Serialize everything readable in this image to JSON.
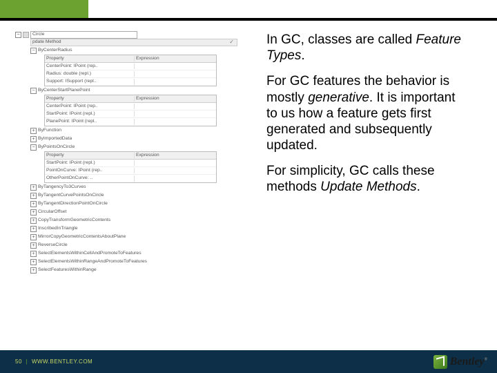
{
  "slide": {
    "paragraphs": [
      {
        "pre": "In GC, classes are called ",
        "em": "Feature Types",
        "post": "."
      },
      {
        "pre": "For GC features the behavior is mostly ",
        "em": "generative",
        "post": ". It is important to us how a feature gets first generated and subsequently updated."
      },
      {
        "pre": "For simplicity, GC calls these methods ",
        "em": "Update Methods",
        "post": "."
      }
    ]
  },
  "tree": {
    "root_exp": "−",
    "root_label": "Circle",
    "method_band": "pdate Method",
    "method_tail": "✓",
    "sections": [
      {
        "exp": "−",
        "label": "ByCenterRadius",
        "props_header": [
          "Property",
          "Expression"
        ],
        "props": [
          [
            "CenterPoint: IPoint (rep..",
            ""
          ],
          [
            "Radius: double (repl.)",
            ""
          ],
          [
            "Support: ISupport (repl..",
            ""
          ]
        ]
      },
      {
        "exp": "−",
        "label": "ByCenterStartPlanePoint",
        "props_header": [
          "Property",
          "Expression"
        ],
        "props": [
          [
            "CenterPoint: IPoint (rep..",
            ""
          ],
          [
            "StartPoint: IPoint (repl.)",
            ""
          ],
          [
            "PlanePoint: IPoint (repl..",
            ""
          ]
        ]
      }
    ],
    "mid_items": [
      {
        "exp": "+",
        "label": "ByFunction"
      },
      {
        "exp": "+",
        "label": "ByImportedData"
      },
      {
        "exp": "−",
        "label": "ByPointsOnCircle",
        "props_header": [
          "Property",
          "Expression"
        ],
        "props": [
          [
            "StartPoint: IPoint (repl.)",
            ""
          ],
          [
            "PointOnCurve: IPoint (rep..",
            ""
          ],
          [
            "OtherPointOnCurve: ..",
            ""
          ]
        ]
      }
    ],
    "tail_items": [
      {
        "exp": "+",
        "label": "ByTangencyTo3Curves"
      },
      {
        "exp": "+",
        "label": "ByTangentCurvePointsOnCircle"
      },
      {
        "exp": "+",
        "label": "ByTangentDirectionPointOnCircle"
      },
      {
        "exp": "+",
        "label": "CircularOffset"
      },
      {
        "exp": "+",
        "label": "CopyTransformGeometricContents"
      },
      {
        "exp": "+",
        "label": "InscribedInTriangle"
      },
      {
        "exp": "+",
        "label": "MirrorCopyGeometricContentsAboutPlane"
      },
      {
        "exp": "+",
        "label": "ReverseCircle"
      },
      {
        "exp": "+",
        "label": "SelectElementsWithinCellAndPromoteToFeatures"
      },
      {
        "exp": "+",
        "label": "SelectElementsWithinRangeAndPromoteToFeatures"
      },
      {
        "exp": "+",
        "label": "SelectFeaturesWithinRange"
      }
    ]
  },
  "footer": {
    "page": "50",
    "sep": "|",
    "url": "WWW.BENTLEY.COM"
  },
  "logo": {
    "text": "Bentley",
    "tm": "®"
  }
}
